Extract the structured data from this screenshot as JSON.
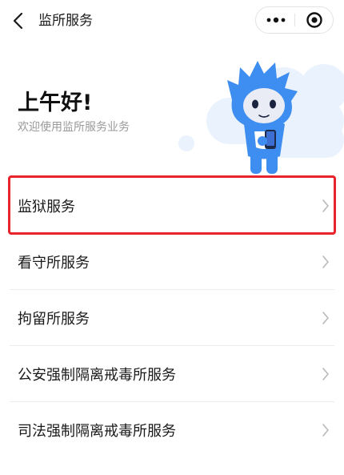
{
  "nav": {
    "title": "监所服务",
    "back_icon": "chevron-left-icon",
    "more_icon": "more-dots-icon",
    "close_icon": "target-close-icon"
  },
  "hero": {
    "greeting": "上午好!",
    "subtitle": "欢迎使用监所服务业务",
    "illustration": "blue-mascot-holding-phone"
  },
  "services": [
    {
      "label": "监狱服务"
    },
    {
      "label": "看守所服务"
    },
    {
      "label": "拘留所服务"
    },
    {
      "label": "公安强制隔离戒毒所服务"
    },
    {
      "label": "司法强制隔离戒毒所服务"
    }
  ],
  "colors": {
    "accent_blue": "#3d8ef0",
    "highlight_red": "#e8232b",
    "cloud_light": "#eaf3fd"
  }
}
